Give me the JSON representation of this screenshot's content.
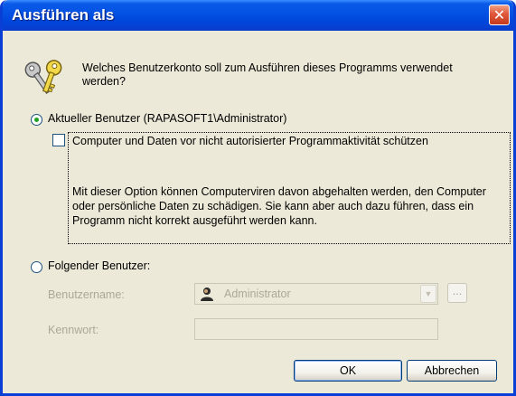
{
  "window": {
    "title": "Ausführen als",
    "close_glyph": "✕"
  },
  "prompt": {
    "question": "Welches Benutzerkonto soll zum Ausführen dieses Programms verwendet werden?",
    "icon": "keys-icon"
  },
  "current_user": {
    "label": "Aktueller Benutzer (RAPASOFT1\\Administrator)",
    "selected": true
  },
  "protect": {
    "label": "Computer und Daten vor nicht autorisierter Programmaktivität schützen",
    "checked": false,
    "description": "Mit dieser Option können Computerviren davon abgehalten werden, den Computer oder persönliche Daten zu schädigen. Sie kann aber auch dazu führen, dass ein Programm nicht korrekt ausgeführt werden kann."
  },
  "other_user": {
    "label": "Folgender Benutzer:",
    "selected": false,
    "username_label": "Benutzername:",
    "username_value": "Administrator",
    "password_label": "Kennwort:",
    "password_value": "",
    "browse_label": "..."
  },
  "buttons": {
    "ok": "OK",
    "cancel": "Abbrechen"
  },
  "colors": {
    "title_bar": "#0451e3",
    "dialog_bg": "#ece9d8",
    "disabled_text": "#aca899"
  }
}
